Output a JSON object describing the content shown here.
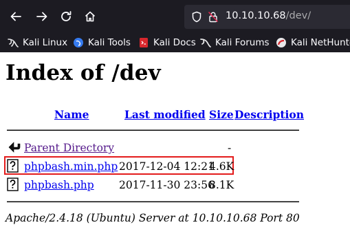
{
  "browser": {
    "url_host": "10.10.10.68",
    "url_path": "/dev/",
    "bookmarks": [
      {
        "label": "Kali Linux",
        "icon": "kali-dragon-icon"
      },
      {
        "label": "Kali Tools",
        "icon": "kali-tools-icon"
      },
      {
        "label": "Kali Docs",
        "icon": "kali-docs-icon"
      },
      {
        "label": "Kali Forums",
        "icon": "kali-forums-icon"
      },
      {
        "label": "Kali NetHunter",
        "icon": "kali-nethunter-icon"
      }
    ]
  },
  "page": {
    "title": "Index of /dev",
    "columns": {
      "name": "Name",
      "modified": "Last modified",
      "size": "Size",
      "description": "Description"
    },
    "rows": [
      {
        "name": "Parent Directory",
        "modified": "",
        "size": "-",
        "icon": "back-folder-icon"
      },
      {
        "name": "phpbash.min.php",
        "modified": "2017-12-04 12:21",
        "size": "4.6K",
        "icon": "unknown-file-icon"
      },
      {
        "name": "phpbash.php",
        "modified": "2017-11-30 23:56",
        "size": "8.1K",
        "icon": "unknown-file-icon"
      }
    ],
    "footer": "Apache/2.4.18 (Ubuntu) Server at 10.10.10.68 Port 80"
  },
  "colors": {
    "link": "#0000ee",
    "visited": "#551a8b",
    "highlight": "#e31b1b",
    "chrome": "#1c1b22"
  }
}
